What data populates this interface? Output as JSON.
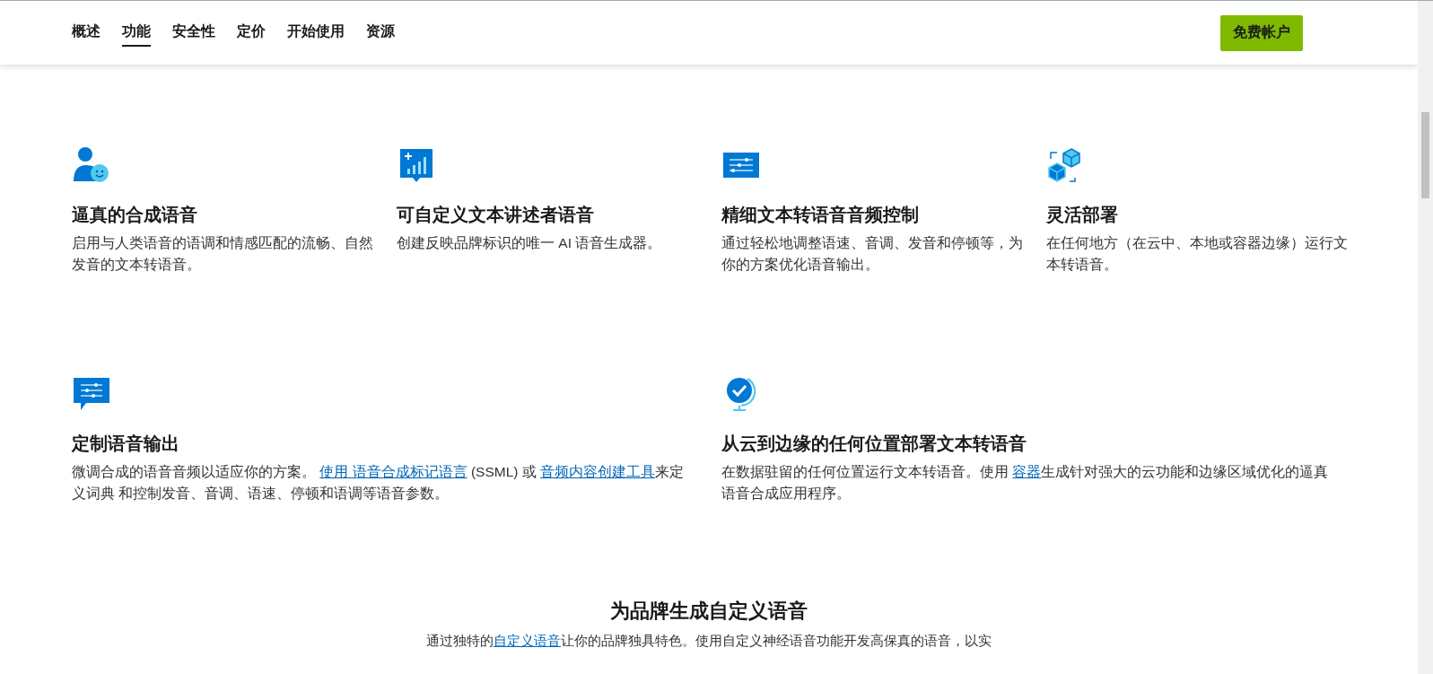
{
  "nav": {
    "items": [
      {
        "label": "概述",
        "selected": false
      },
      {
        "label": "功能",
        "selected": true
      },
      {
        "label": "安全性",
        "selected": false
      },
      {
        "label": "定价",
        "selected": false
      },
      {
        "label": "开始使用",
        "selected": false
      },
      {
        "label": "资源",
        "selected": false
      }
    ],
    "cta_button": "免费帐户"
  },
  "feature_rows": [
    [
      {
        "kind": "person",
        "title": "逼真的合成语音",
        "description": [
          {
            "text": "启用与人类语音的语调和情感匹配的流畅、自然发音的文本转语音。"
          }
        ]
      },
      {
        "kind": "chart",
        "title": "可自定义文本讲述者语音",
        "description": [
          {
            "text": "创建反映品牌标识的唯一 AI 语音生成器。"
          }
        ]
      },
      {
        "kind": "sliders",
        "title": "精细文本转语音音频控制",
        "description": [
          {
            "text": "通过轻松地调整语速、音调、发音和停顿等，为你的方案优化语音输出。"
          }
        ]
      },
      {
        "kind": "cubes",
        "title": "灵活部署",
        "description": [
          {
            "text": "在任何地方（在云中、本地或容器边缘）运行文本转语音。"
          }
        ]
      }
    ],
    [
      {
        "kind": "chat",
        "title": "定制语音输出",
        "description": [
          {
            "text": "微调合成的语音音频以适应你的方案。 "
          },
          {
            "link": "使用 语音合成标记语言"
          },
          {
            "text": " (SSML) 或 "
          },
          {
            "link": "音频内容创建工具"
          },
          {
            "text": "来定义词典 和控制发音、音调、语速、停顿和语调等语音参数。"
          }
        ]
      },
      {
        "kind": "globe",
        "title": "从云到边缘的任何位置部署文本转语音",
        "description": [
          {
            "text": "在数据驻留的任何位置运行文本转语音。使用 "
          },
          {
            "link": "容器"
          },
          {
            "text": "生成针对强大的云功能和边缘区域优化的逼真语音合成应用程序。"
          }
        ]
      }
    ]
  ],
  "next_section": {
    "title": "为品牌生成自定义语音",
    "description": [
      {
        "text": "通过独特的"
      },
      {
        "link": "自定义语音"
      },
      {
        "text": "让你的品牌独具特色。使用自定义神经语音功能开发高保真的语音，以实"
      }
    ]
  }
}
